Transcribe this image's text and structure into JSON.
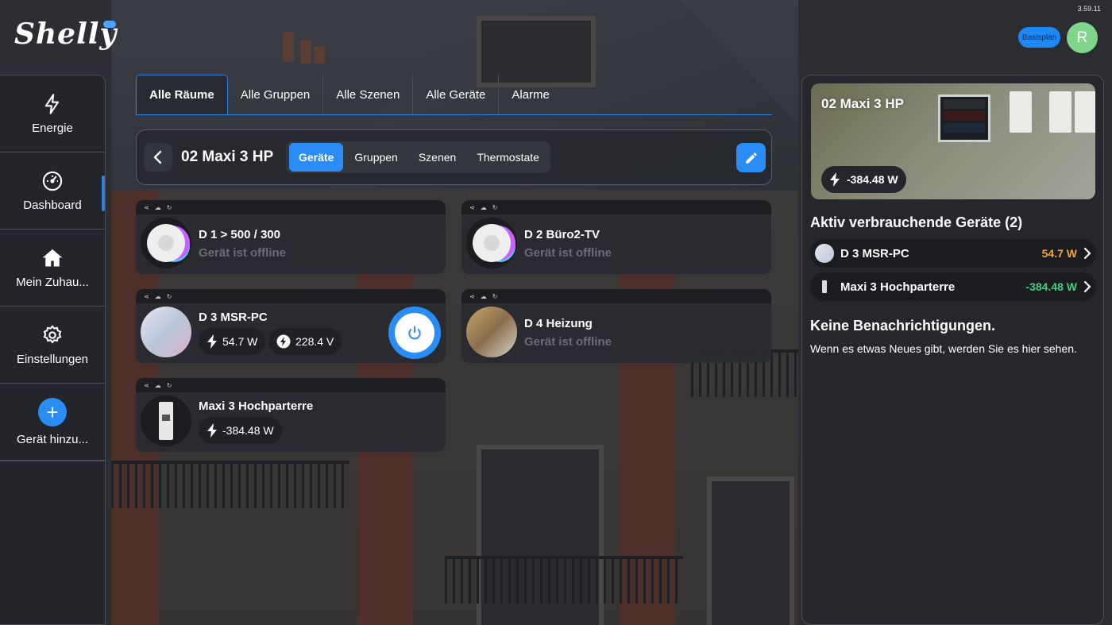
{
  "status_bar": {
    "time": "3.59.11"
  },
  "brand": {
    "logo": "Shelly"
  },
  "header": {
    "plan_badge": "Basisplan",
    "avatar_initial": "R"
  },
  "sidebar": {
    "items": [
      {
        "label": "Energie",
        "icon": "lightning-icon"
      },
      {
        "label": "Dashboard",
        "icon": "gauge-icon"
      },
      {
        "label": "Mein Zuhau...",
        "icon": "home-icon",
        "active": true
      },
      {
        "label": "Einstellungen",
        "icon": "gear-icon"
      },
      {
        "label": "Gerät hinzu...",
        "icon": "plus-icon"
      }
    ]
  },
  "tabs": [
    {
      "label": "Alle Räume",
      "active": true
    },
    {
      "label": "Alle Gruppen"
    },
    {
      "label": "Alle Szenen"
    },
    {
      "label": "Alle Geräte"
    },
    {
      "label": "Alarme"
    }
  ],
  "room": {
    "title": "02 Maxi 3 HP",
    "segments": [
      {
        "label": "Geräte",
        "active": true
      },
      {
        "label": "Gruppen"
      },
      {
        "label": "Szenen"
      },
      {
        "label": "Thermostate"
      }
    ]
  },
  "devices": [
    {
      "name": "D 1 > 500 / 300",
      "status": "Gerät ist offline"
    },
    {
      "name": "D 2 Büro2-TV",
      "status": "Gerät ist offline"
    },
    {
      "name": "D 3 MSR-PC",
      "power": "54.7 W",
      "voltage": "228.4 V"
    },
    {
      "name": "D 4 Heizung",
      "status": "Gerät ist offline"
    },
    {
      "name": "Maxi 3 Hochparterre",
      "power": "-384.48 W"
    }
  ],
  "right_panel": {
    "hero_title": "02 Maxi 3 HP",
    "hero_power": "-384.48 W",
    "active_heading": "Aktiv verbrauchende Geräte (2)",
    "active_devices": [
      {
        "name": "D 3 MSR-PC",
        "value": "54.7 W",
        "color": "#f5a623"
      },
      {
        "name": "Maxi 3 Hochparterre",
        "value": "-384.48 W",
        "color": "#3ecf7a"
      }
    ],
    "notif_heading": "Keine Benachrichtigungen.",
    "notif_text": "Wenn es etwas Neues gibt, werden Sie es hier sehen."
  },
  "colors": {
    "accent": "#2a8cf5",
    "offline_text": "#6a6d74"
  }
}
